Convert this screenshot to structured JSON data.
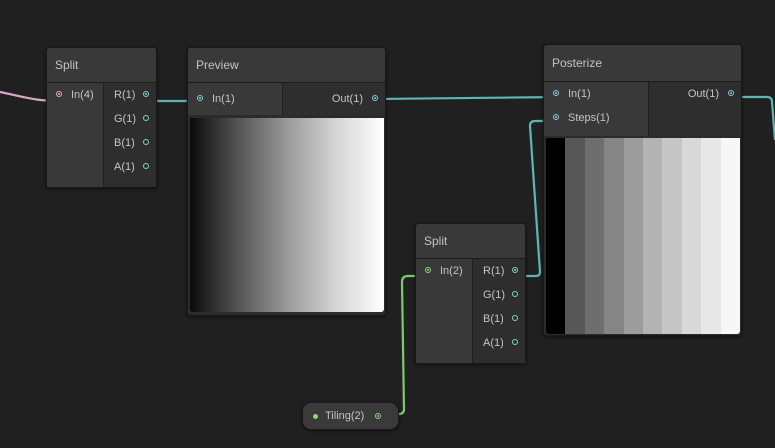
{
  "colors": {
    "background": "#202020",
    "wire_vector1": "#5fb6b6",
    "wire_vector2": "#7fc770",
    "wire_vector4": "#d9a7c8"
  },
  "nodes": {
    "split1": {
      "title": "Split",
      "inputs": [
        "In(4)"
      ],
      "outputs": [
        "R(1)",
        "G(1)",
        "B(1)",
        "A(1)"
      ]
    },
    "preview": {
      "title": "Preview",
      "inputs": [
        "In(1)"
      ],
      "outputs": [
        "Out(1)"
      ]
    },
    "posterize": {
      "title": "Posterize",
      "inputs": [
        "In(1)",
        "Steps(1)"
      ],
      "outputs": [
        "Out(1)"
      ]
    },
    "split2": {
      "title": "Split",
      "inputs": [
        "In(2)"
      ],
      "outputs": [
        "R(1)",
        "G(1)",
        "B(1)",
        "A(1)"
      ]
    },
    "tiling": {
      "label": "Tiling(2)"
    }
  }
}
